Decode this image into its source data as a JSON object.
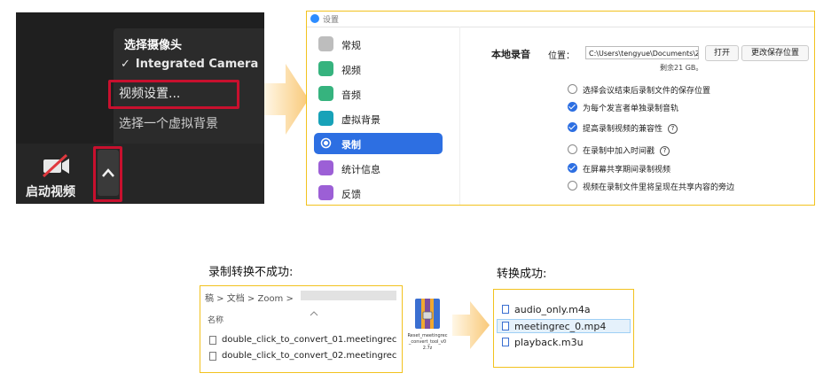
{
  "zoom": {
    "menu_heading": "选择摄像头",
    "camera_item": "Integrated Camera",
    "check_mark": "✓",
    "video_settings": "视频设置...",
    "virtual_background": "选择一个虚拟背景",
    "start_video": "启动视频",
    "caret": "^"
  },
  "settings": {
    "title": "设置",
    "nav": [
      {
        "label": "常规",
        "icon": "gear-icon",
        "color": "#9a9a9a"
      },
      {
        "label": "视频",
        "icon": "video-icon",
        "color": "#36b37e"
      },
      {
        "label": "音频",
        "icon": "headphones-icon",
        "color": "#36b37e"
      },
      {
        "label": "虚拟背景",
        "icon": "person-icon",
        "color": "#17a2b8"
      },
      {
        "label": "录制",
        "icon": "record-icon",
        "color": "#2d6fe2"
      },
      {
        "label": "统计信息",
        "icon": "stats-icon",
        "color": "#9c5fd6"
      },
      {
        "label": "反馈",
        "icon": "smile-icon",
        "color": "#9c5fd6"
      }
    ],
    "active_nav": "录制",
    "local_recording_label": "本地录音",
    "location_label": "位置：",
    "path_value": "C:\\Users\\tengyue\\Documents\\Zc",
    "open_button": "打开",
    "change_button": "更改保存位置",
    "free_space": "剩余21 GB。",
    "options": [
      {
        "label": "选择会议结束后录制文件的保存位置",
        "checked": false,
        "help": false
      },
      {
        "label": "为每个发言者单独录制音轨",
        "checked": true,
        "help": false
      },
      {
        "label": "提高录制视频的兼容性",
        "checked": true,
        "help": true
      },
      {
        "label": "在录制中加入时间戳",
        "checked": false,
        "help": true
      },
      {
        "label": "在屏幕共享期间录制视频",
        "checked": true,
        "help": false
      },
      {
        "label": "视频在录制文件里将呈现在共享内容的旁边",
        "checked": false,
        "help": false
      }
    ],
    "help_glyph": "?"
  },
  "fail": {
    "caption": "录制转换不成功:",
    "breadcrumb": "稿  >  文档  >  Zoom  >",
    "column_header": "名称",
    "files": [
      "double_click_to_convert_01.meetingrec",
      "double_click_to_convert_02.meetingrec"
    ]
  },
  "tool": {
    "label": "Reset_meetingrec_convert_tool_v02.7z"
  },
  "success": {
    "caption": "转换成功:",
    "files": [
      "audio_only.m4a",
      "meetingrec_0.mp4",
      "playback.m3u"
    ]
  },
  "colors": {
    "highlight_red": "#c8102e",
    "accent_blue": "#2d6fe2",
    "frame_yellow": "#f2c21e",
    "arrow_fill": "#fbd48a"
  }
}
